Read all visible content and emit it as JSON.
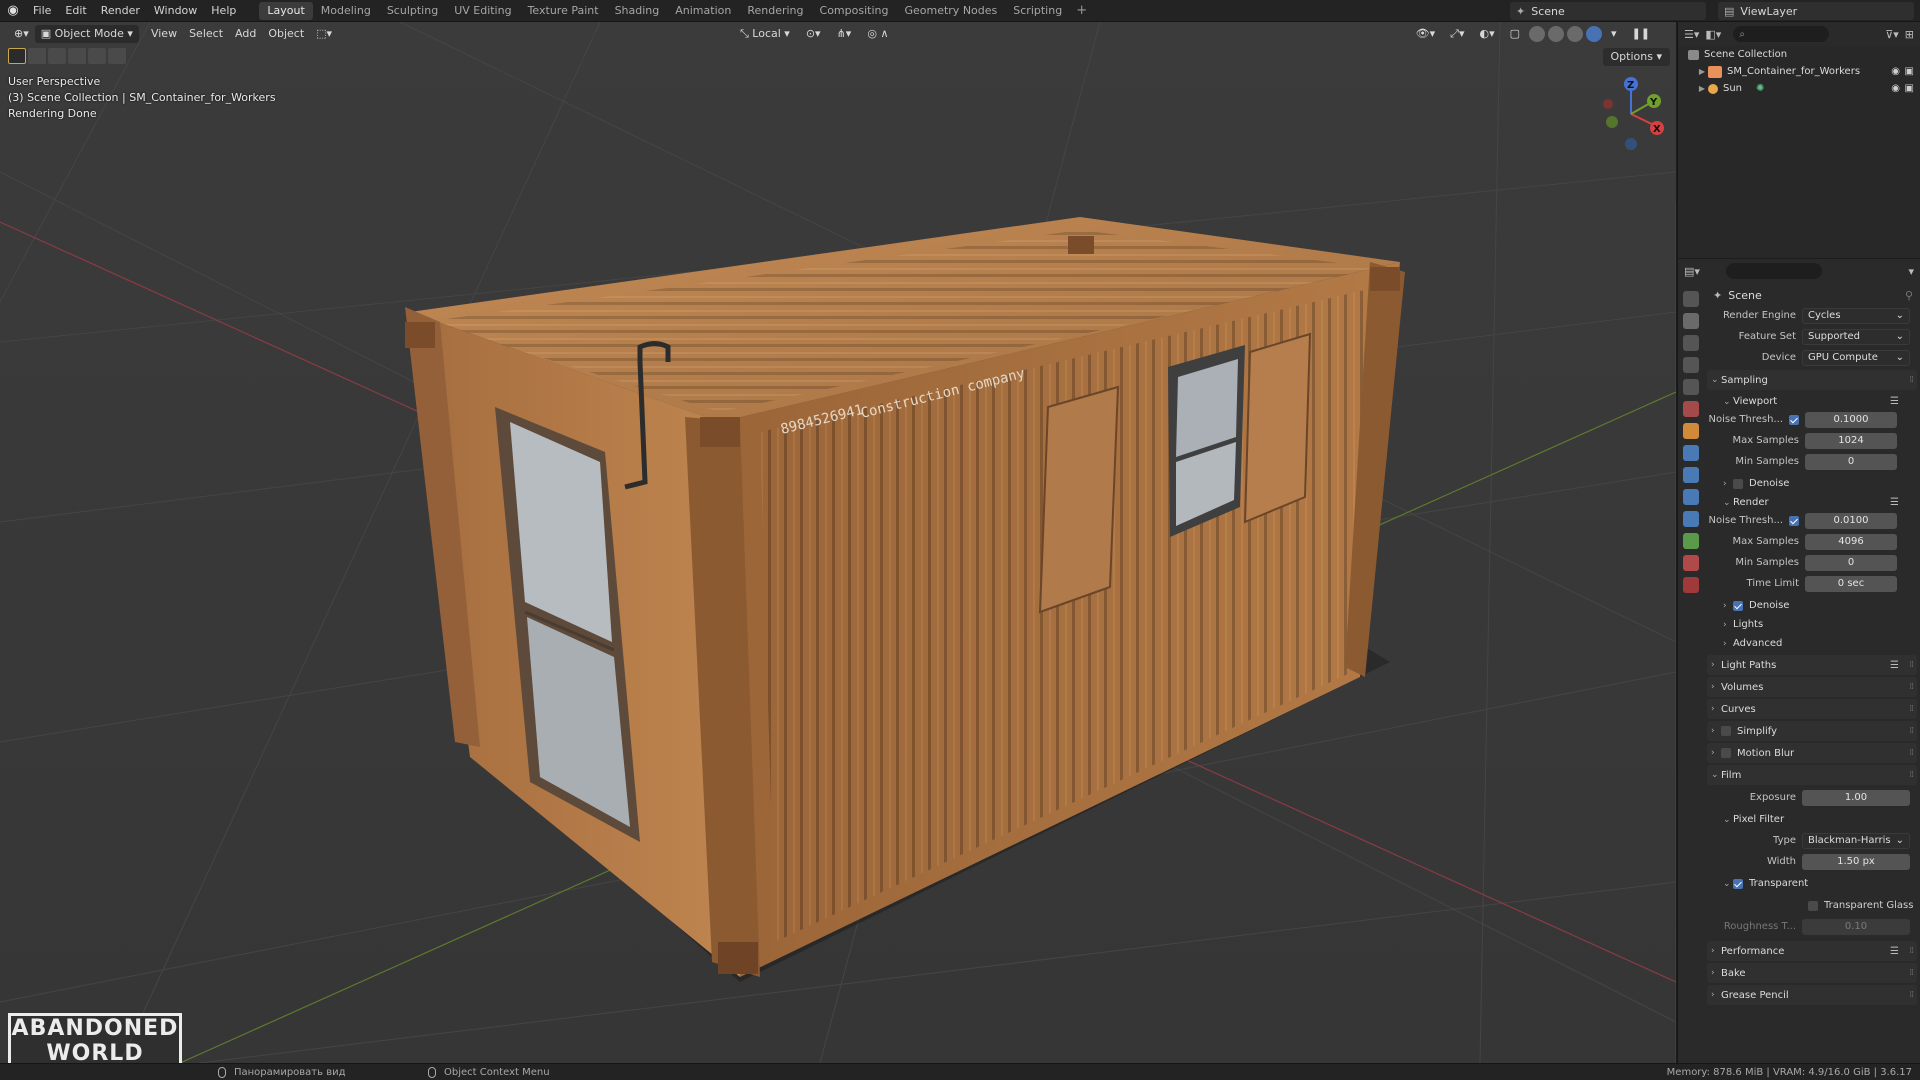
{
  "menubar": {
    "items": [
      "File",
      "Edit",
      "Render",
      "Window",
      "Help"
    ],
    "workspaces": [
      "Layout",
      "Modeling",
      "Sculpting",
      "UV Editing",
      "Texture Paint",
      "Shading",
      "Animation",
      "Rendering",
      "Compositing",
      "Geometry Nodes",
      "Scripting"
    ],
    "active_workspace": "Layout",
    "add_tab": "+",
    "scene": "Scene",
    "view_layer": "ViewLayer"
  },
  "viewport": {
    "mode": "Object Mode",
    "menus": [
      "View",
      "Select",
      "Add",
      "Object"
    ],
    "orientation": "Local",
    "options": "Options",
    "overlay_lines": [
      "User Perspective",
      "(3) Scene Collection | SM_Container_for_Workers",
      "Rendering Done"
    ],
    "gizmo": {
      "x": "X",
      "y": "Y",
      "z": "Z"
    },
    "container_text": {
      "number": "8984526941",
      "company": "Construction company"
    },
    "watermark": [
      "ABANDONED",
      "WORLD"
    ]
  },
  "outliner": {
    "collection": "Scene Collection",
    "objects": [
      {
        "name": "SM_Container_for_Workers",
        "icon": "mesh-icon"
      },
      {
        "name": "Sun",
        "icon": "light-icon"
      }
    ]
  },
  "properties": {
    "context": "Scene",
    "render_engine": {
      "label": "Render Engine",
      "value": "Cycles"
    },
    "feature_set": {
      "label": "Feature Set",
      "value": "Supported"
    },
    "device": {
      "label": "Device",
      "value": "GPU Compute"
    },
    "sampling": {
      "title": "Sampling",
      "viewport": {
        "title": "Viewport",
        "noise_label": "Noise Thresh...",
        "noise_value": "0.1000",
        "max_label": "Max Samples",
        "max_value": "1024",
        "min_label": "Min Samples",
        "min_value": "0",
        "denoise": "Denoise"
      },
      "render": {
        "title": "Render",
        "noise_label": "Noise Thresh...",
        "noise_value": "0.0100",
        "max_label": "Max Samples",
        "max_value": "4096",
        "min_label": "Min Samples",
        "min_value": "0",
        "time_label": "Time Limit",
        "time_value": "0 sec",
        "denoise": "Denoise"
      },
      "lights": "Lights",
      "advanced": "Advanced"
    },
    "panels": {
      "light_paths": "Light Paths",
      "volumes": "Volumes",
      "curves": "Curves",
      "simplify": "Simplify",
      "motion_blur": "Motion Blur"
    },
    "film": {
      "title": "Film",
      "exposure_label": "Exposure",
      "exposure_value": "1.00",
      "pixel_filter": "Pixel Filter",
      "type_label": "Type",
      "type_value": "Blackman-Harris",
      "width_label": "Width",
      "width_value": "1.50 px",
      "transparent": "Transparent",
      "transparent_glass": "Transparent Glass",
      "roughness_label": "Roughness T...",
      "roughness_value": "0.10"
    },
    "more_panels": {
      "performance": "Performance",
      "bake": "Bake",
      "grease_pencil": "Grease Pencil"
    }
  },
  "statusbar": {
    "pan": "Панорамировать вид",
    "context_menu": "Object Context Menu",
    "stats": "Memory: 878.6 MiB | VRAM: 4.9/16.0 GiB | 3.6.17"
  },
  "colors": {
    "accent": "#4772b3",
    "container": "#b97c45",
    "viewport_bg": "#3a3a3a"
  }
}
